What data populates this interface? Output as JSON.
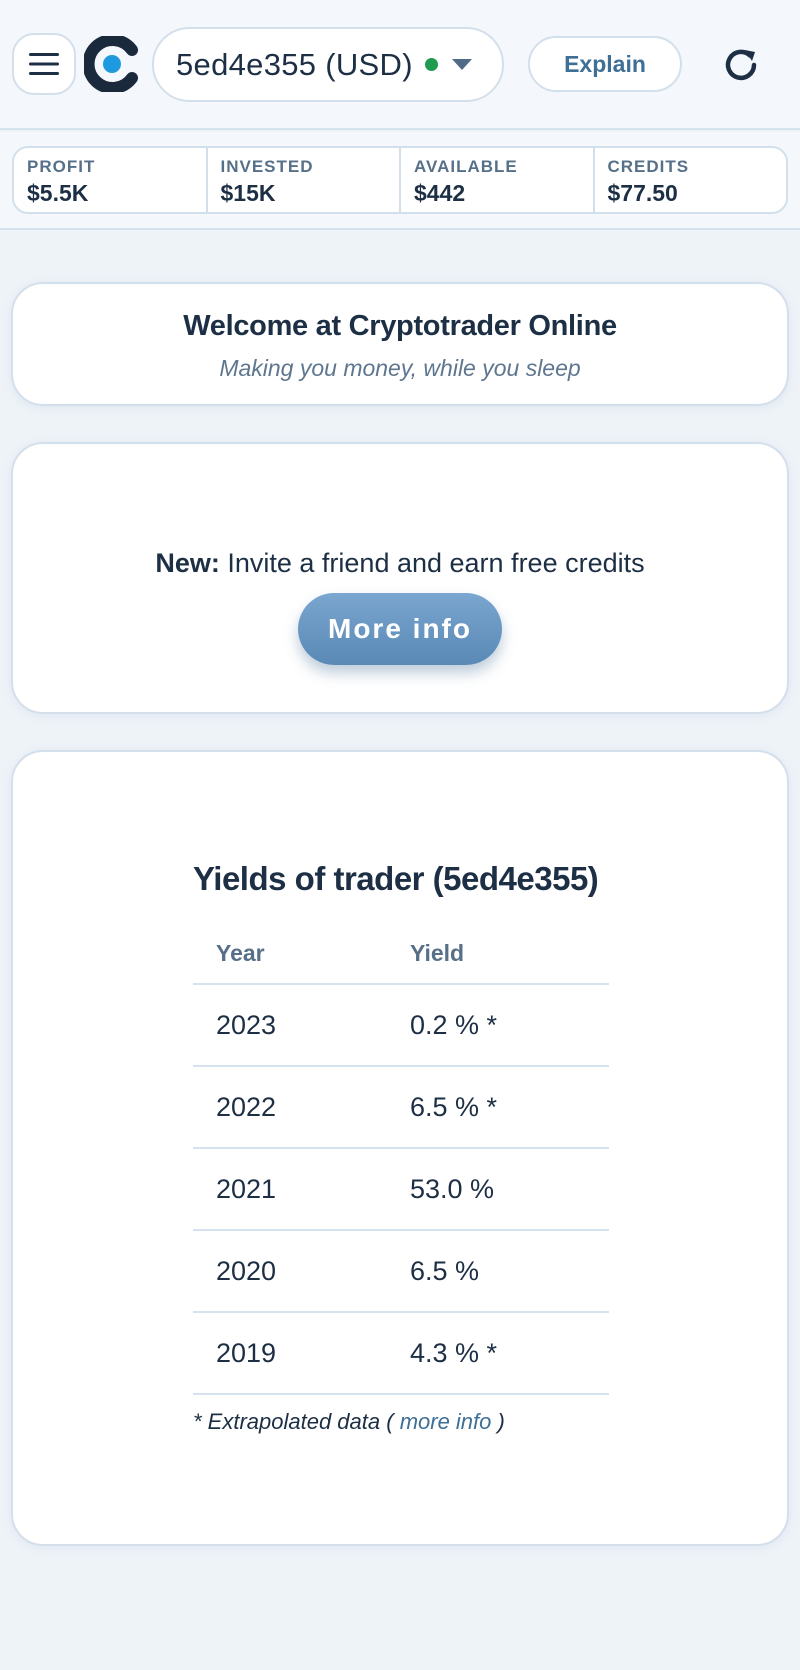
{
  "header": {
    "account_label": "5ed4e355 (USD)",
    "status_color": "#1f9a4e",
    "explain_label": "Explain",
    "icons": {
      "menu": "hamburger-icon",
      "logo": "cryptotrader-logo-icon",
      "dropdown": "chevron-down-icon",
      "refresh": "refresh-icon"
    }
  },
  "stats": [
    {
      "label": "PROFIT",
      "value": "$5.5K"
    },
    {
      "label": "INVESTED",
      "value": "$15K"
    },
    {
      "label": "AVAILABLE",
      "value": "$442"
    },
    {
      "label": "CREDITS",
      "value": "$77.50"
    }
  ],
  "welcome": {
    "title": "Welcome at Cryptotrader Online",
    "subtitle": "Making you money, while you sleep"
  },
  "invite": {
    "prefix": "New:",
    "text": " Invite a friend and earn free credits",
    "button_label": "More info"
  },
  "yields": {
    "title": "Yields of trader (5ed4e355)",
    "columns": [
      "Year",
      "Yield"
    ],
    "rows": [
      {
        "year": "2023",
        "yield": "0.2 % *"
      },
      {
        "year": "2022",
        "yield": "6.5 % *"
      },
      {
        "year": "2021",
        "yield": "53.0 %"
      },
      {
        "year": "2020",
        "yield": "6.5 %"
      },
      {
        "year": "2019",
        "yield": "4.3 % *"
      }
    ],
    "footnote_prefix": "* Extrapolated data ( ",
    "footnote_link": "more info",
    "footnote_suffix": " )"
  },
  "colors": {
    "accent": "#5a89b6",
    "text": "#1d2f44",
    "muted": "#577089",
    "border": "#d3e0ec"
  }
}
